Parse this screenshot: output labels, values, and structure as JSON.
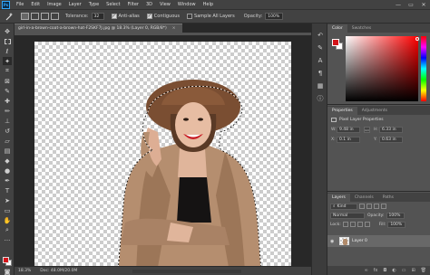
{
  "app": {
    "logo": "Ps"
  },
  "menu": [
    "File",
    "Edit",
    "Image",
    "Layer",
    "Type",
    "Select",
    "Filter",
    "3D",
    "View",
    "Window",
    "Help"
  ],
  "window_controls": [
    "—",
    "▭",
    "✕"
  ],
  "options": {
    "tolerance_label": "Tolerance:",
    "tolerance_value": "32",
    "antialias_label": "Anti-alias",
    "contiguous_label": "Contiguous",
    "sample_all_label": "Sample All Layers",
    "opacity_label": "Opacity:",
    "opacity_value": "100%"
  },
  "document": {
    "tab_title": "girl-in-a-brown-coat-a-brown-hat-F2SKF7J.jpg @ 18.3% (Layer 0, RGB/8*)",
    "close": "×"
  },
  "status": {
    "zoom": "18.3%",
    "doc": "Doc: 48.0M/20.0M"
  },
  "color_panel": {
    "tabs": [
      "Color",
      "Swatches"
    ],
    "fg": "#d3141a",
    "bg": "#ffffff"
  },
  "properties_panel": {
    "tabs": [
      "Properties",
      "Adjustments"
    ],
    "title": "Pixel Layer Properties",
    "w_label": "W:",
    "w_value": "9.48 in",
    "go_label": "GO",
    "h_label": "H:",
    "h_value": "6.33 in",
    "x_label": "X:",
    "x_value": "0.1 in",
    "y_label": "Y:",
    "y_value": "0.63 in"
  },
  "layers_panel": {
    "tabs": [
      "Layers",
      "Channels",
      "Paths"
    ],
    "kind_label": "Kind",
    "blend_mode": "Normal",
    "opacity_label": "Opacity:",
    "opacity_value": "100%",
    "lock_label": "Lock:",
    "fill_label": "Fill:",
    "fill_value": "100%",
    "layer_name": "Layer 0"
  }
}
